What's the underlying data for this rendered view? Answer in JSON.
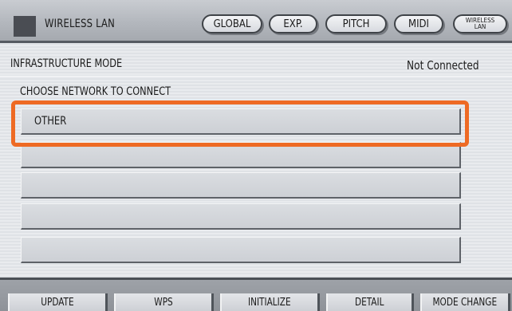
{
  "header": {
    "title": "WIRELESS LAN",
    "tabs": [
      "GLOBAL",
      "EXP.",
      "PITCH",
      "MIDI"
    ],
    "active_tab_line1": "WIRELESS",
    "active_tab_line2": "LAN"
  },
  "main": {
    "mode_label": "INFRASTRUCTURE MODE",
    "status": "Not Connected",
    "choose_label": "CHOOSE NETWORK TO CONNECT",
    "networks": [
      "OTHER",
      "",
      "",
      "",
      ""
    ]
  },
  "footer": {
    "buttons": [
      "UPDATE",
      "WPS",
      "INITIALIZE",
      "DETAIL",
      "MODE CHANGE"
    ]
  },
  "colors": {
    "highlight": "#ee6a24"
  }
}
